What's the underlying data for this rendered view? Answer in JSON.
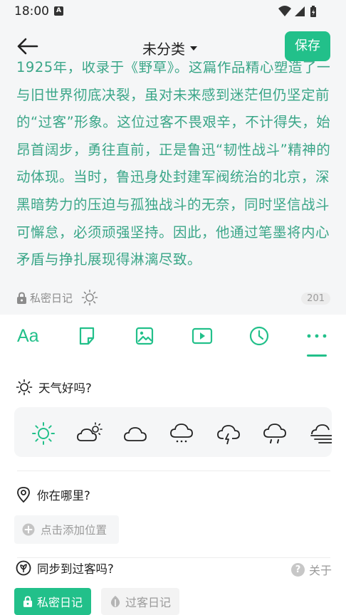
{
  "status": {
    "time": "18:00",
    "notification_letter": "A"
  },
  "header": {
    "category": "未分类",
    "save_label": "保存"
  },
  "article": {
    "lines": [
      "1925年，收录于《野草》。这篇作品精心塑造了一个",
      "与旧世界彻底决裂，虽对未来感到迷茫但仍坚定前行",
      "的“过客”形象。这位过客不畏艰辛，不计得失，始终",
      "昂首阔步，勇往直前，正是鲁迅“韧性战斗”精神的生",
      "动体现。当时，鲁迅身处封建军阀统治的北京，深感",
      "黑暗势力的压迫与孤独战斗的无奈，同时坚信战斗不",
      "可懈怠，必须顽强坚持。因此，他通过笔墨将内心的",
      "矛盾与挣扎展现得淋漓尽致。"
    ],
    "text_color": "#3aa688"
  },
  "meta": {
    "privacy_label": "私密日记",
    "word_count": "201"
  },
  "toolbar": {
    "font_label": "Aa",
    "tools": [
      "font-icon",
      "sticker-icon",
      "image-icon",
      "video-icon",
      "clock-icon",
      "more-icon"
    ]
  },
  "weather": {
    "question": "天气好吗?",
    "options": [
      "sunny-icon",
      "partly-cloudy-icon",
      "cloudy-icon",
      "light-rain-icon",
      "thunderstorm-icon",
      "heavy-rain-icon",
      "fog-icon"
    ],
    "selected": "sunny-icon"
  },
  "location": {
    "question": "你在哪里?",
    "add_label": "点击添加位置"
  },
  "sync": {
    "question": "同步到过客吗?",
    "about_label": "关于",
    "private_label": "私密日记",
    "passer_label": "过客日记"
  },
  "colors": {
    "accent": "#22c08a",
    "background": "#f5f6f7"
  }
}
